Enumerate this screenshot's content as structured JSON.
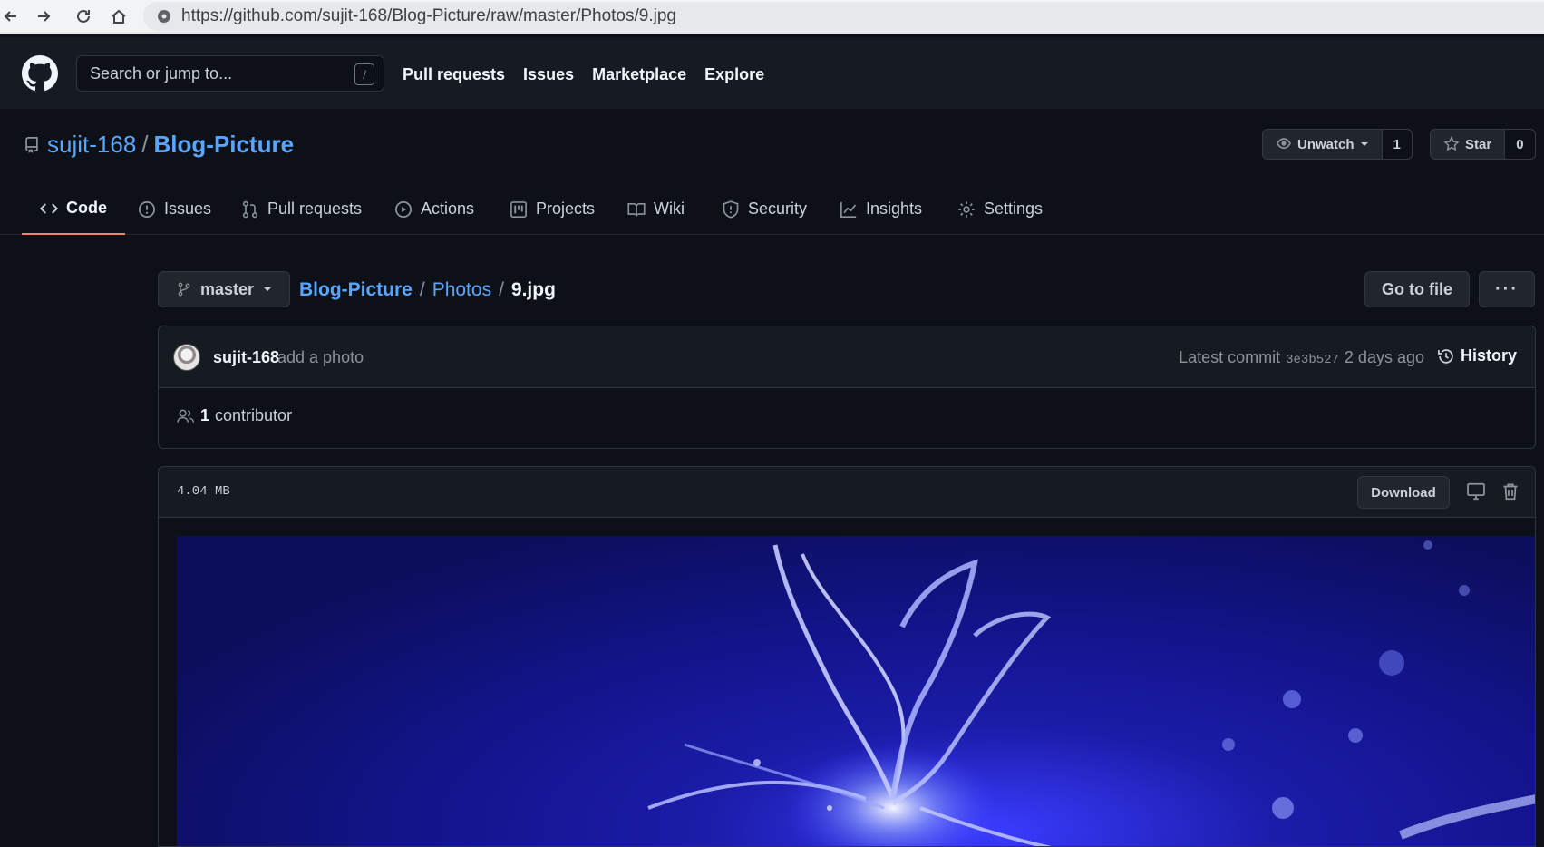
{
  "browser": {
    "url": "https://github.com/sujit-168/Blog-Picture/raw/master/Photos/9.jpg"
  },
  "header": {
    "search_placeholder": "Search or jump to...",
    "search_shortcut": "/",
    "nav": [
      "Pull requests",
      "Issues",
      "Marketplace",
      "Explore"
    ]
  },
  "repo": {
    "owner": "sujit-168",
    "separator": "/",
    "name": "Blog-Picture",
    "watch_label": "Unwatch",
    "watch_count": "1",
    "star_label": "Star",
    "star_count": "0"
  },
  "tabs": [
    {
      "label": "Code",
      "icon": "code-icon",
      "selected": true
    },
    {
      "label": "Issues",
      "icon": "issue-icon"
    },
    {
      "label": "Pull requests",
      "icon": "pull-request-icon"
    },
    {
      "label": "Actions",
      "icon": "play-icon"
    },
    {
      "label": "Projects",
      "icon": "project-icon"
    },
    {
      "label": "Wiki",
      "icon": "book-icon"
    },
    {
      "label": "Security",
      "icon": "shield-icon"
    },
    {
      "label": "Insights",
      "icon": "graph-icon"
    },
    {
      "label": "Settings",
      "icon": "gear-icon"
    }
  ],
  "file_nav": {
    "branch": "master",
    "crumbs": [
      "Blog-Picture",
      "Photos"
    ],
    "separator": "/",
    "current_file": "9.jpg",
    "go_to_file": "Go to file",
    "more": "···"
  },
  "commit": {
    "author": "sujit-168",
    "message": "add a photo",
    "latest_label": "Latest commit",
    "sha": "3e3b527",
    "age": "2 days ago",
    "history_label": "History",
    "contributors_count": "1",
    "contributors_label": "contributor"
  },
  "file": {
    "size": "4.04 MB",
    "download_label": "Download"
  },
  "colors": {
    "background": "#0d1117",
    "header": "#161b22",
    "link": "#58a6ff",
    "tab_underline": "#f78166"
  }
}
